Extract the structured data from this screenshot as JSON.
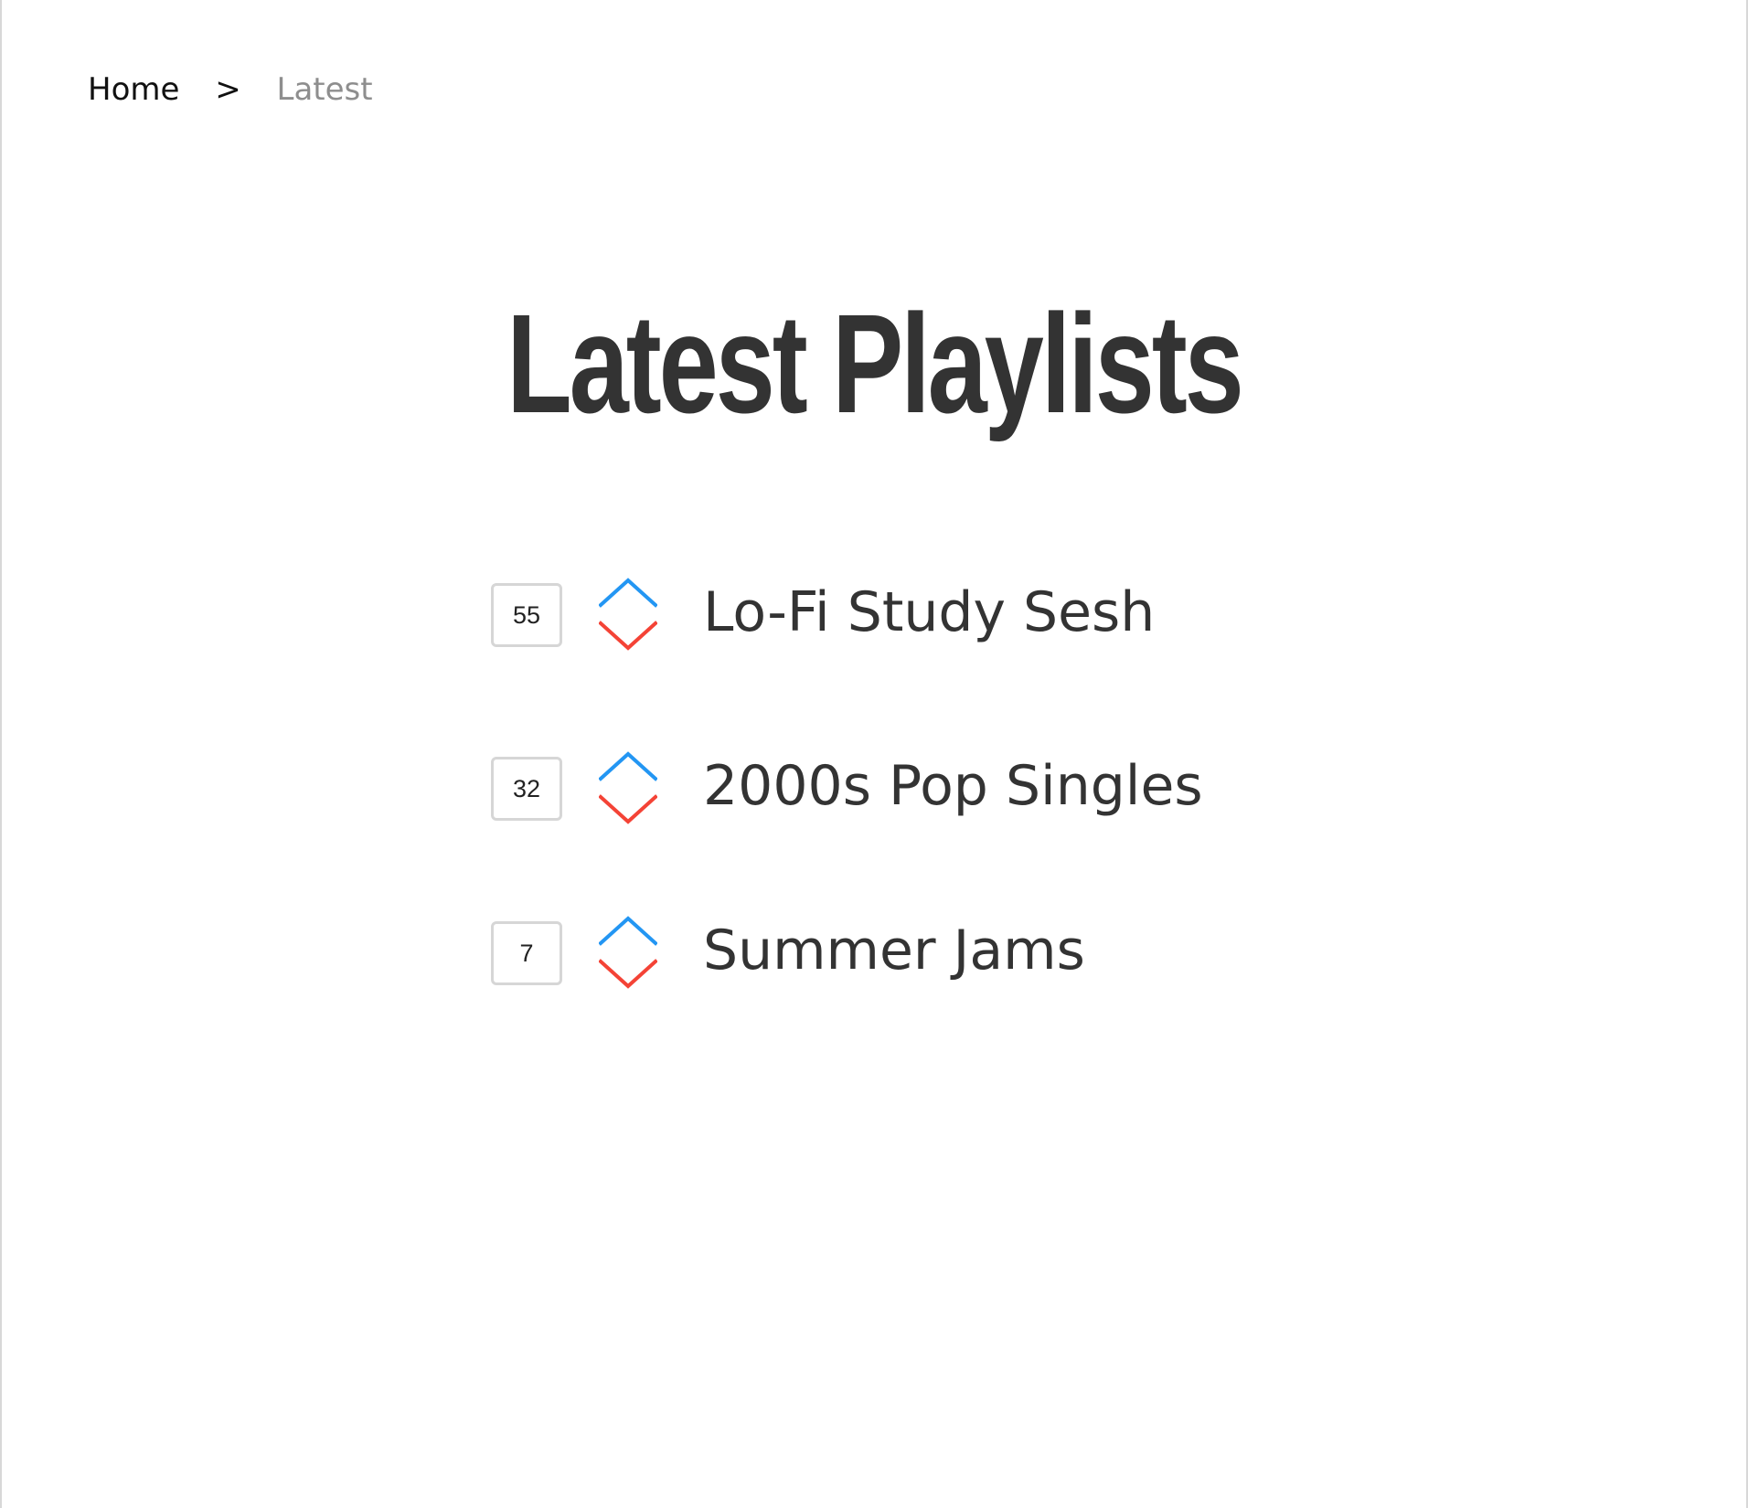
{
  "breadcrumb": {
    "home": "Home",
    "separator": ">",
    "current": "Latest"
  },
  "page": {
    "title": "Latest Playlists"
  },
  "playlists": [
    {
      "score": "55",
      "title": "Lo-Fi Study Sesh"
    },
    {
      "score": "32",
      "title": "2000s Pop Singles"
    },
    {
      "score": "7",
      "title": "Summer Jams"
    }
  ],
  "icons": {
    "upvote": "chevron-up-icon",
    "downvote": "chevron-down-icon"
  },
  "colors": {
    "upvote": "#2396f3",
    "downvote": "#f44336",
    "title": "#333333",
    "breadcrumb_current": "#8e8e8e"
  }
}
